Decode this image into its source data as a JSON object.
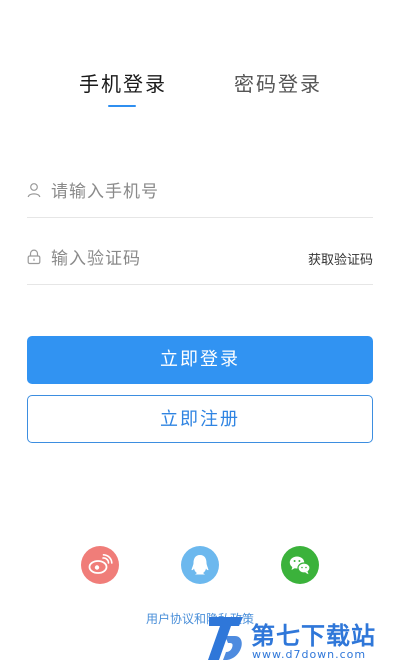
{
  "tabs": {
    "phone_login": "手机登录",
    "password_login": "密码登录"
  },
  "form": {
    "phone_placeholder": "请输入手机号",
    "code_placeholder": "输入验证码",
    "get_code": "获取验证码"
  },
  "buttons": {
    "login": "立即登录",
    "register": "立即注册"
  },
  "social": [
    {
      "icon": "weibo-icon",
      "color": "#f07d79"
    },
    {
      "icon": "qq-icon",
      "color": "#6cb8ee"
    },
    {
      "icon": "wechat-icon",
      "color": "#3bb23b"
    }
  ],
  "footer": {
    "policy": "用户协议和隐私政策"
  },
  "watermark": {
    "title": "第七下载站",
    "url": "www.d7down.com"
  },
  "colors": {
    "accent": "#3193f2",
    "outline": "#3d8ee0"
  }
}
